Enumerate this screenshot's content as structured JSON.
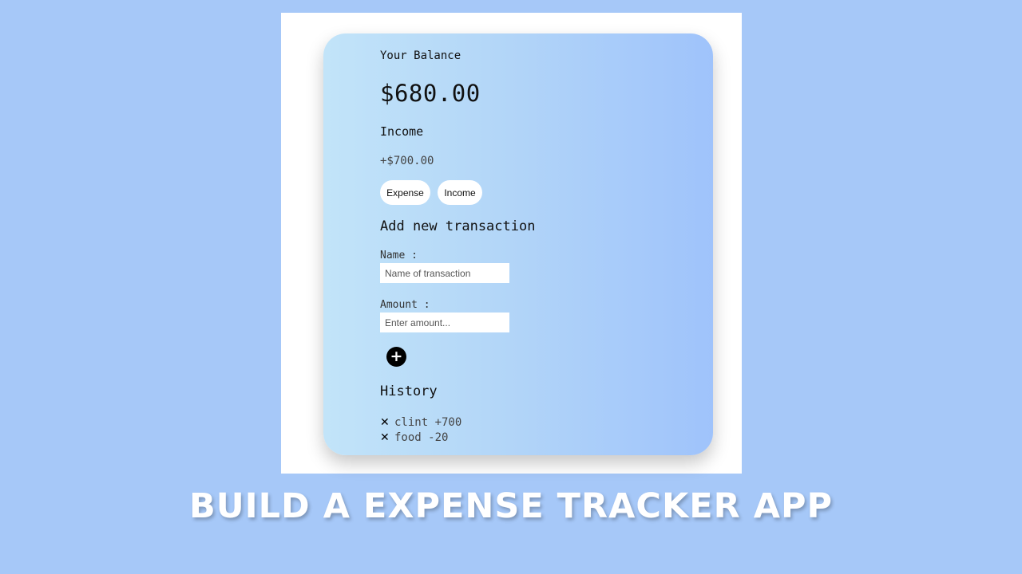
{
  "app": {
    "balance_label": "Your Balance",
    "balance_value": "$680.00",
    "income_label": "Income",
    "income_value": "+$700.00",
    "buttons": {
      "expense": "Expense",
      "income": "Income"
    },
    "form": {
      "title": "Add new transaction",
      "name_label": "Name :",
      "name_placeholder": "Name of transaction",
      "amount_label": "Amount :",
      "amount_placeholder": "Enter amount...",
      "add_icon": "plus-icon",
      "add_glyph": "+"
    },
    "history": {
      "title": "History",
      "delete_icon": "close-icon",
      "delete_glyph": "✕",
      "items": [
        {
          "text": "clint +700"
        },
        {
          "text": "food -20"
        }
      ]
    }
  },
  "headline": "BUILD A EXPENSE TRACKER APP",
  "colors": {
    "page_background": "#a6c8f8",
    "card_gradient_start": "#c2e4f9",
    "card_gradient_end": "#9fc3fb",
    "add_button": "#000000"
  }
}
